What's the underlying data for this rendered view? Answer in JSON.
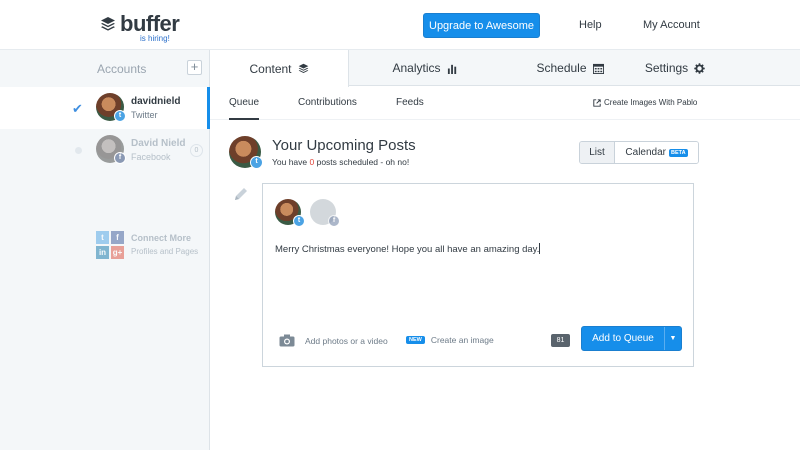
{
  "header": {
    "logo_text": "buffer",
    "logo_sub": "is hiring!",
    "upgrade_label": "Upgrade to Awesome",
    "help_label": "Help",
    "account_label": "My Account"
  },
  "sidebar": {
    "title": "Accounts",
    "add_label": "+",
    "profiles": [
      {
        "name": "davidnield",
        "network": "Twitter",
        "active": true
      },
      {
        "name": "David Nield",
        "network": "Facebook",
        "active": false,
        "count": "0"
      }
    ],
    "connect": {
      "title": "Connect More",
      "subtitle": "Profiles and Pages"
    }
  },
  "tabs": [
    {
      "label": "Content",
      "icon": "layers-icon",
      "active": true
    },
    {
      "label": "Analytics",
      "icon": "bar-chart-icon"
    },
    {
      "label": "Schedule",
      "icon": "calendar-icon"
    },
    {
      "label": "Settings",
      "icon": "gear-icon"
    }
  ],
  "subtabs": [
    {
      "label": "Queue",
      "active": true
    },
    {
      "label": "Contributions"
    },
    {
      "label": "Feeds"
    }
  ],
  "pablo_link": "Create Images With Pablo",
  "queue_heading": {
    "title": "Your Upcoming Posts",
    "subtitle_prefix": "You have ",
    "count": "0",
    "subtitle_suffix": " posts scheduled - oh no!"
  },
  "view_toggle": {
    "list": "List",
    "calendar": "Calendar",
    "beta": "BETA"
  },
  "composer": {
    "text": "Merry Christmas everyone! Hope you all have an amazing day.",
    "add_media": "Add photos or a video",
    "new_badge": "NEW",
    "create_image": "Create an image",
    "char_count": "81",
    "submit_label": "Add to Queue"
  },
  "colors": {
    "accent": "#168eea",
    "alert": "#e0443a",
    "twitter": "#4ba3e4"
  }
}
